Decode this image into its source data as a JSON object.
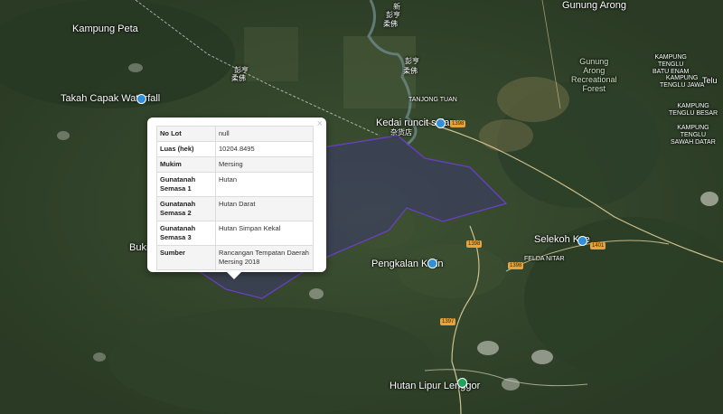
{
  "map": {
    "places": {
      "kampung_peta": "Kampung Peta",
      "takah_capak": "Takah Capak Waterfall",
      "gunung_arong": "Gunung Arong",
      "gunung_arong_forest": [
        "Gunung",
        "Arong",
        "Recreational",
        "Forest"
      ],
      "kampung_tenglu_batu_enam": [
        "KAMPUNG",
        "TENGLU",
        "BATU ENAM"
      ],
      "kampung_tenglu_jawa": [
        "KAMPUNG",
        "TENGLU JAWA"
      ],
      "kampung_tenglu_besar": [
        "KAMPUNG",
        "TENGLU BESAR"
      ],
      "kampung_tenglu_sawah": [
        "KAMPUNG",
        "TENGLU",
        "SAWAH DATAR"
      ],
      "telu": "Telu",
      "tanjong_tuan": "TANJONG TUAN",
      "kedai_runcit": "Kedai runcit salan",
      "kedai_runcit_chinese": "杂货店",
      "bukit": "Bukit",
      "pengkalan_kolin": "Pengkalan Kolin",
      "selekoh_kze": "Selekoh Kze",
      "felda_nitar": "FELDA NITAR",
      "hutan_lipur_lenggor": "Hutan Lipur Lenggor",
      "chinese_1": "新",
      "chinese_2": "彭亨",
      "chinese_3": "柔佛",
      "chinese_4": "彭亨",
      "chinese_5": "柔佛",
      "chinese_6": "彭亨",
      "chinese_7": "柔佛"
    },
    "roads": {
      "r1": "1398",
      "r2": "1398",
      "r3": "1398",
      "r4": "1397",
      "r5": "1401"
    },
    "colors": {
      "boundary": "#6b3fc4",
      "region_fill": "#3c3a6e",
      "road": "#e8d6a0",
      "pin_blue": "#2f8fd8",
      "pin_green": "#1fa25a"
    }
  },
  "popup": {
    "close_label": "×",
    "rows": [
      {
        "key": "No Lot",
        "value": "null"
      },
      {
        "key": "Luas (hek)",
        "value": "10204.8495"
      },
      {
        "key": "Mukim",
        "value": "Mersing"
      },
      {
        "key": "Gunatanah Semasa 1",
        "value": "Hutan"
      },
      {
        "key": "Gunatanah Semasa 2",
        "value": "Hutan Darat"
      },
      {
        "key": "Gunatanah Semasa 3",
        "value": "Hutan Simpan Kekal"
      },
      {
        "key": "Sumber",
        "value": "Rancangan Tempatan Daerah Mersing 2018"
      }
    ]
  }
}
